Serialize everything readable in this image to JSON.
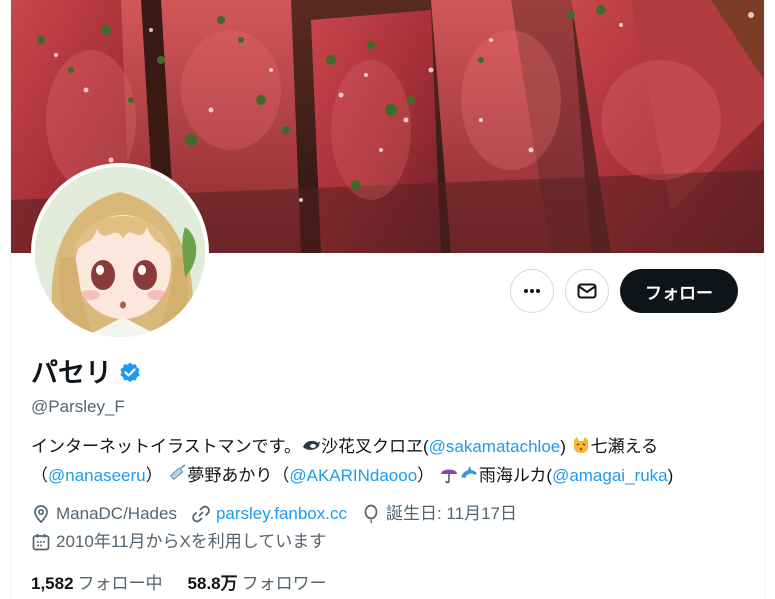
{
  "profile": {
    "display_name": "パセリ",
    "handle": "@Parsley_F",
    "verified": true,
    "follow_label": "フォロー"
  },
  "bio": {
    "line1_text": "インターネットイラストマンです。",
    "line1_name1": "沙花叉クロヱ(",
    "mention1": "@sakamatachloe",
    "line1_close1": ")",
    "line1_name2": "七瀬える",
    "line2_open": "（",
    "mention2": "@nanaseeru",
    "line2_close": "）",
    "line2_name3": "夢野あかり（",
    "mention3": "@AKARINdaooo",
    "line2_close3": "）",
    "line2_name4": "雨海ルカ(",
    "mention4": "@amagai_ruka",
    "line2_close4": ")"
  },
  "meta": {
    "location": "ManaDC/Hades",
    "website": "parsley.fanbox.cc",
    "birthday": "誕生日: 11月17日",
    "joined": "2010年11月からXを利用しています"
  },
  "stats": {
    "following_count": "1,582",
    "following_label": "フォロー中",
    "followers_count": "58.8万",
    "followers_label": "フォロワー"
  },
  "icons": {
    "more": "more-dots-icon",
    "message": "envelope-icon",
    "verified": "verified-badge-icon",
    "location": "location-pin-icon",
    "link": "link-icon",
    "birthday": "balloon-icon",
    "calendar": "calendar-icon"
  },
  "colors": {
    "accent": "#1d9bf0",
    "text_primary": "#0f1419",
    "text_secondary": "#536471",
    "follow_button_bg": "#0f1419"
  }
}
